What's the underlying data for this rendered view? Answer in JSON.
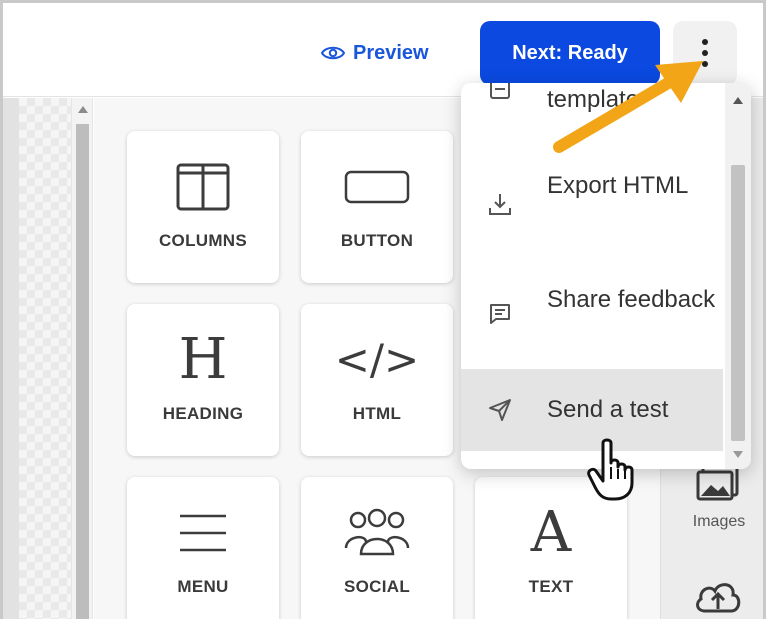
{
  "header": {
    "preview_label": "Preview",
    "next_label": "Next: Ready",
    "more_menu_icon": "kebab-vertical-icon",
    "accent_color": "#0b49e0",
    "preview_color": "#1a56db"
  },
  "blocks": [
    {
      "label": "COLUMNS",
      "icon": "columns-icon"
    },
    {
      "label": "BUTTON",
      "icon": "button-icon"
    },
    {
      "label": "HEADING",
      "icon": "heading-icon",
      "glyph": "H"
    },
    {
      "label": "HTML",
      "icon": "code-icon",
      "glyph": "</>"
    },
    {
      "label": "MENU",
      "icon": "menu-icon"
    },
    {
      "label": "SOCIAL",
      "icon": "people-icon"
    },
    {
      "label": "TEXT",
      "icon": "text-icon",
      "glyph": "A"
    }
  ],
  "dropdown": {
    "items": [
      {
        "label": "template",
        "icon": "template-icon"
      },
      {
        "label": "Export HTML",
        "icon": "download-icon"
      },
      {
        "label": "Share feedback",
        "icon": "message-icon"
      },
      {
        "label": "Send a test",
        "icon": "send-icon",
        "hovered": true
      }
    ]
  },
  "side_panel": {
    "images_label": "Images",
    "images_icon": "images-icon",
    "upload_icon": "cloud-upload-icon"
  }
}
